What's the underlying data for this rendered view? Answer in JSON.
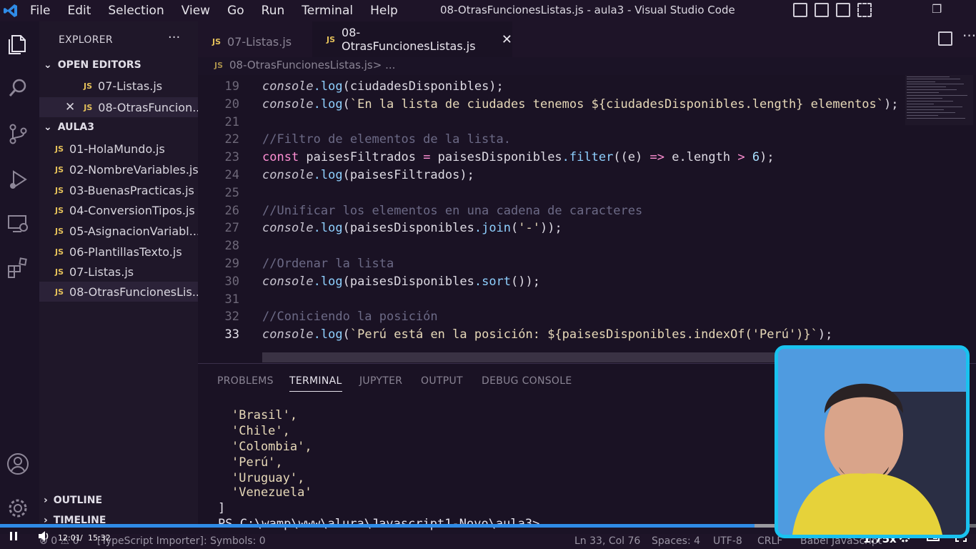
{
  "titlebar": {
    "menu": [
      "File",
      "Edit",
      "Selection",
      "View",
      "Go",
      "Run",
      "Terminal",
      "Help"
    ],
    "title": "08-OtrasFuncionesListas.js - aula3 - Visual Studio Code"
  },
  "sidebar": {
    "header": "EXPLORER",
    "more": "···",
    "open_editors_label": "OPEN EDITORS",
    "open_editors": [
      {
        "badge": "JS",
        "name": "07-Listas.js"
      },
      {
        "badge": "JS",
        "name": "08-OtrasFuncion..."
      }
    ],
    "folder_label": "AULA3",
    "files": [
      {
        "badge": "JS",
        "name": "01-HolaMundo.js"
      },
      {
        "badge": "JS",
        "name": "02-NombreVariables.js"
      },
      {
        "badge": "JS",
        "name": "03-BuenasPracticas.js"
      },
      {
        "badge": "JS",
        "name": "04-ConversionTipos.js"
      },
      {
        "badge": "JS",
        "name": "05-AsignacionVariabl..."
      },
      {
        "badge": "JS",
        "name": "06-PlantillasTexto.js"
      },
      {
        "badge": "JS",
        "name": "07-Listas.js"
      },
      {
        "badge": "JS",
        "name": "08-OtrasFuncionesLis..."
      }
    ],
    "outline_label": "OUTLINE",
    "timeline_label": "TIMELINE"
  },
  "tabs": [
    {
      "badge": "JS",
      "label": "07-Listas.js",
      "active": false
    },
    {
      "badge": "JS",
      "label": "08-OtrasFuncionesListas.js",
      "active": true
    }
  ],
  "breadcrumb": {
    "badge": "JS",
    "file": "08-OtrasFuncionesListas.js",
    "rest": " > ..."
  },
  "editor": {
    "lines": [
      {
        "n": "19",
        "text": "console.log(ciudadesDisponibles);"
      },
      {
        "n": "20",
        "text": "console.log(`En la lista de ciudades tenemos ${ciudadesDisponibles.length} elementos`);"
      },
      {
        "n": "21",
        "text": ""
      },
      {
        "n": "22",
        "text": "//Filtro de elementos de la lista."
      },
      {
        "n": "23",
        "text": "const paisesFiltrados = paisesDisponibles.filter((e) => e.length > 6);"
      },
      {
        "n": "24",
        "text": "console.log(paisesFiltrados);"
      },
      {
        "n": "25",
        "text": ""
      },
      {
        "n": "26",
        "text": "//Unificar los elementos en una cadena de caracteres"
      },
      {
        "n": "27",
        "text": "console.log(paisesDisponibles.join('-'));"
      },
      {
        "n": "28",
        "text": ""
      },
      {
        "n": "29",
        "text": "//Ordenar la lista"
      },
      {
        "n": "30",
        "text": "console.log(paisesDisponibles.sort());"
      },
      {
        "n": "31",
        "text": ""
      },
      {
        "n": "32",
        "text": "//Coniciendo la posición"
      },
      {
        "n": "33",
        "text": "console.log(`Perú está en la posición: ${paisesDisponibles.indexOf('Perú')}`);"
      }
    ]
  },
  "panel": {
    "tabs": [
      "PROBLEMS",
      "TERMINAL",
      "JUPYTER",
      "OUTPUT",
      "DEBUG CONSOLE"
    ],
    "active_tab": "TERMINAL",
    "terminal_lines": [
      "'Brasil',",
      "'Chile',",
      "'Colombia',",
      "'Perú',",
      "'Uruguay',",
      "'Venezuela'"
    ],
    "close": "]",
    "prompt": "PS C:\\wamp\\www\\alura\\Javascript1-Novo\\aula3>"
  },
  "statusbar": {
    "errors": "0",
    "warnings": "0",
    "ts": "[TypeScript Importer]: Symbols: 0",
    "position": "Ln 33, Col 76",
    "spaces": "Spaces: 4",
    "encoding": "UTF-8",
    "eol": "CRLF",
    "language": "Babel JavaScript"
  },
  "player": {
    "time_current": "12:01",
    "separator": "/",
    "time_total": "15:32",
    "speed": "1.75x",
    "progress_fraction": 0.773
  }
}
